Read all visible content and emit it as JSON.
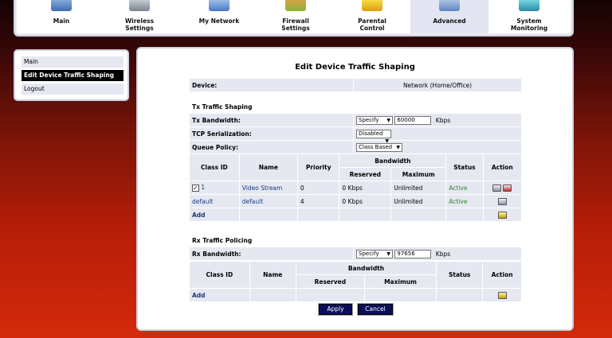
{
  "nav": {
    "items": [
      {
        "label": "Main",
        "icon": "main-icon"
      },
      {
        "label": "Wireless\nSettings",
        "icon": "wireless-icon"
      },
      {
        "label": "My Network",
        "icon": "network-icon"
      },
      {
        "label": "Firewall\nSettings",
        "icon": "firewall-icon"
      },
      {
        "label": "Parental\nControl",
        "icon": "lock-icon"
      },
      {
        "label": "Advanced",
        "icon": "advanced-icon"
      },
      {
        "label": "System\nMonitoring",
        "icon": "monitor-icon"
      }
    ],
    "active": "Advanced"
  },
  "sidebar": {
    "items": [
      {
        "label": "Main"
      },
      {
        "label": "Edit Device Traffic Shaping"
      },
      {
        "label": "Logout"
      }
    ]
  },
  "page": {
    "title": "Edit Device Traffic Shaping"
  },
  "device": {
    "label": "Device:",
    "value": "Network (Home/Office)"
  },
  "tx": {
    "section": "Tx Traffic Shaping",
    "bandwidth_label": "Tx Bandwidth:",
    "bandwidth_mode": "Specify",
    "bandwidth_value": "60000",
    "bandwidth_unit": "Kbps",
    "tcp_label": "TCP Serialization:",
    "tcp_value": "Disabled",
    "queue_label": "Queue Policy:",
    "queue_value": "Class Based",
    "headers": {
      "class_id": "Class ID",
      "name": "Name",
      "priority": "Priority",
      "bandwidth": "Bandwidth",
      "reserved": "Reserved",
      "maximum": "Maximum",
      "status": "Status",
      "action": "Action"
    },
    "rows": [
      {
        "class_id": "1",
        "name": "Video Stream",
        "priority": "0",
        "reserved": "0 Kbps",
        "maximum": "Unlimited",
        "status": "Active"
      },
      {
        "class_id": "default",
        "name": "default",
        "priority": "4",
        "reserved": "0 Kbps",
        "maximum": "Unlimited",
        "status": "Active"
      }
    ],
    "add": "Add"
  },
  "rx": {
    "section": "Rx Traffic Policing",
    "bandwidth_label": "Rx Bandwidth:",
    "bandwidth_mode": "Specify",
    "bandwidth_value": "97656",
    "bandwidth_unit": "Kbps",
    "headers": {
      "class_id": "Class ID",
      "name": "Name",
      "bandwidth": "Bandwidth",
      "reserved": "Reserved",
      "maximum": "Maximum",
      "status": "Status",
      "action": "Action"
    },
    "add": "Add"
  },
  "buttons": {
    "apply": "Apply",
    "cancel": "Cancel"
  },
  "colors": {
    "accent": "#0a0e5a",
    "status_active": "#2a8a2a",
    "row_bg": "#e6e8f1"
  }
}
